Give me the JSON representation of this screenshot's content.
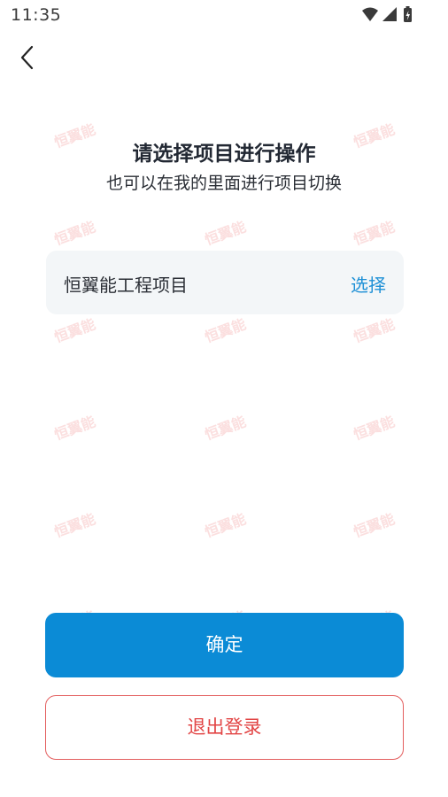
{
  "status_bar": {
    "time": "11:35",
    "icons": [
      "wifi-icon",
      "cellular-signal-icon",
      "battery-icon"
    ]
  },
  "header": {
    "back_icon": "chevron-left-icon"
  },
  "main": {
    "title": "请选择项目进行操作",
    "subtitle": "也可以在我的里面进行项目切换",
    "project": {
      "name": "恒翼能工程项目",
      "action_label": "选择"
    }
  },
  "watermark": {
    "text": "恒翼能"
  },
  "buttons": {
    "confirm_label": "确定",
    "logout_label": "退出登录"
  },
  "colors": {
    "accent": "#0b8bd6",
    "danger": "#e24545",
    "card_bg": "#f3f6f8"
  }
}
